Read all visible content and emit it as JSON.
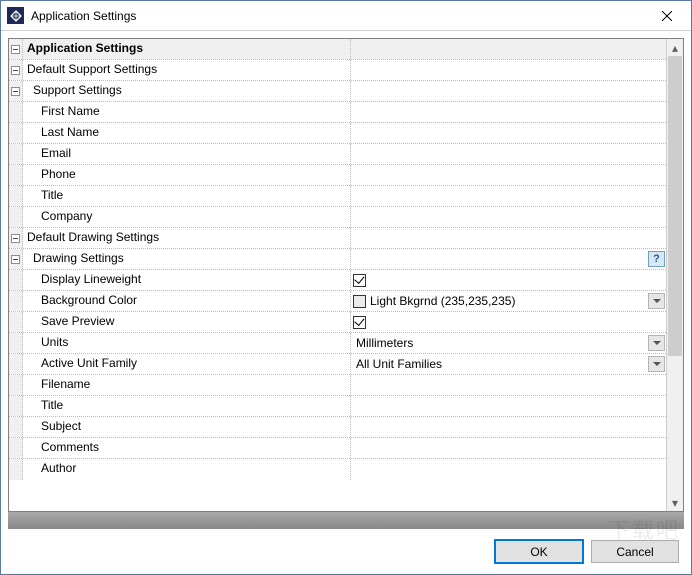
{
  "window": {
    "title": "Application Settings",
    "close_glyph": "×"
  },
  "sections": {
    "app_settings": "Application Settings",
    "default_support": "Default Support Settings",
    "support": "Support Settings",
    "first_name": "First Name",
    "last_name": "Last Name",
    "email": "Email",
    "phone": "Phone",
    "title": "Title",
    "company": "Company",
    "default_drawing": "Default Drawing Settings",
    "drawing": "Drawing Settings",
    "display_lw": "Display Lineweight",
    "bg_color": "Background Color",
    "save_preview": "Save Preview",
    "units": "Units",
    "active_unit_family": "Active Unit Family",
    "filename": "Filename",
    "dtitle": "Title",
    "subject": "Subject",
    "comments": "Comments",
    "author": "Author"
  },
  "values": {
    "display_lw_checked": true,
    "bg_color_swatch": "#ebebeb",
    "bg_color_label": "Light Bkgrnd (235,235,235)",
    "save_preview_checked": true,
    "units": "Millimeters",
    "active_unit_family": "All Unit Families",
    "help_glyph": "?"
  },
  "buttons": {
    "ok": "OK",
    "cancel": "Cancel"
  },
  "watermark": "下载吧"
}
